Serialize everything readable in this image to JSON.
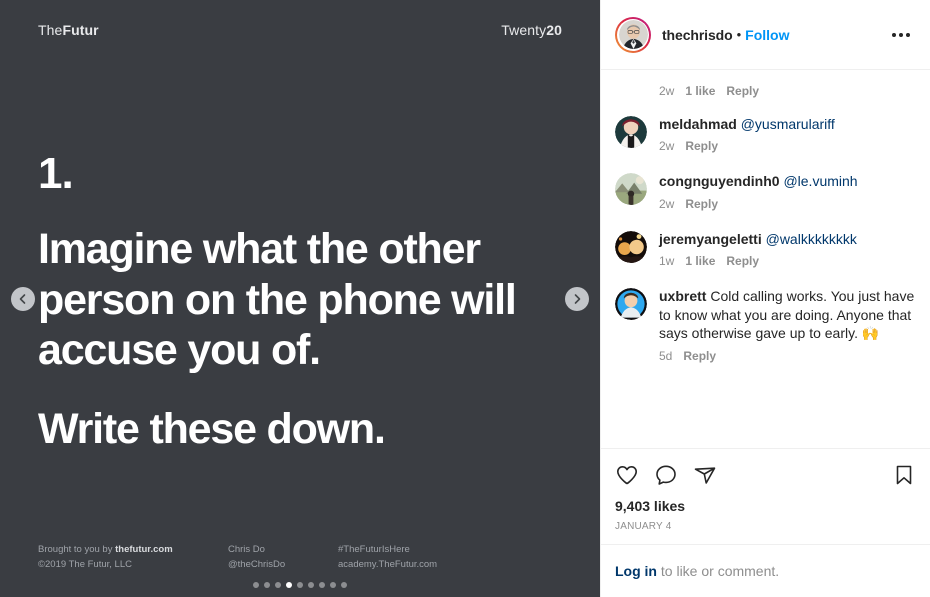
{
  "slide": {
    "brand_left_light": "The",
    "brand_left_bold": "Futur",
    "brand_right_light": "Twenty",
    "brand_right_bold": "20",
    "number": "1.",
    "headline": "Imagine what the other person on the phone will accuse you of.",
    "subline": "Write these down.",
    "footer": {
      "col1_line1_pre": "Brought to you by ",
      "col1_line1_bold": "thefutur.com",
      "col1_line2": "©2019 The Futur, LLC",
      "col2_line1": "Chris Do",
      "col2_line2": "@theChrisDo",
      "col3_line1": "#TheFuturIsHere",
      "col3_line2": "academy.TheFutur.com"
    },
    "prev_label": "Previous",
    "next_label": "Next",
    "dot_count": 9,
    "active_dot": 3,
    "background_color": "#3a3d42"
  },
  "header": {
    "username": "thechrisdo",
    "separator": "•",
    "follow_label": "Follow",
    "more_label": "More options",
    "follow_color": "#0095f6"
  },
  "top_partial_comment": {
    "time": "2w",
    "likes": "1 like",
    "reply": "Reply"
  },
  "comments": [
    {
      "username": "meldahmad",
      "mention": "@yusmarulariff",
      "text": "",
      "time": "2w",
      "likes": "",
      "reply": "Reply"
    },
    {
      "username": "congnguyendinh0",
      "mention": "@le.vuminh",
      "text": "",
      "time": "2w",
      "likes": "",
      "reply": "Reply"
    },
    {
      "username": "jeremyangeletti",
      "mention": "@walkkkkkkkk",
      "text": "",
      "time": "1w",
      "likes": "1 like",
      "reply": "Reply"
    },
    {
      "username": "uxbrett",
      "mention": "",
      "text": "Cold calling works. You just have to know what you are doing. Anyone that says otherwise gave up to early. 🙌",
      "time": "5d",
      "likes": "",
      "reply": "Reply"
    }
  ],
  "actions": {
    "like_label": "Like",
    "comment_label": "Comment",
    "share_label": "Share",
    "save_label": "Save"
  },
  "stats": {
    "likes": "9,403 likes",
    "date": "JANUARY 4"
  },
  "login": {
    "link": "Log in",
    "rest": " to like or comment."
  }
}
